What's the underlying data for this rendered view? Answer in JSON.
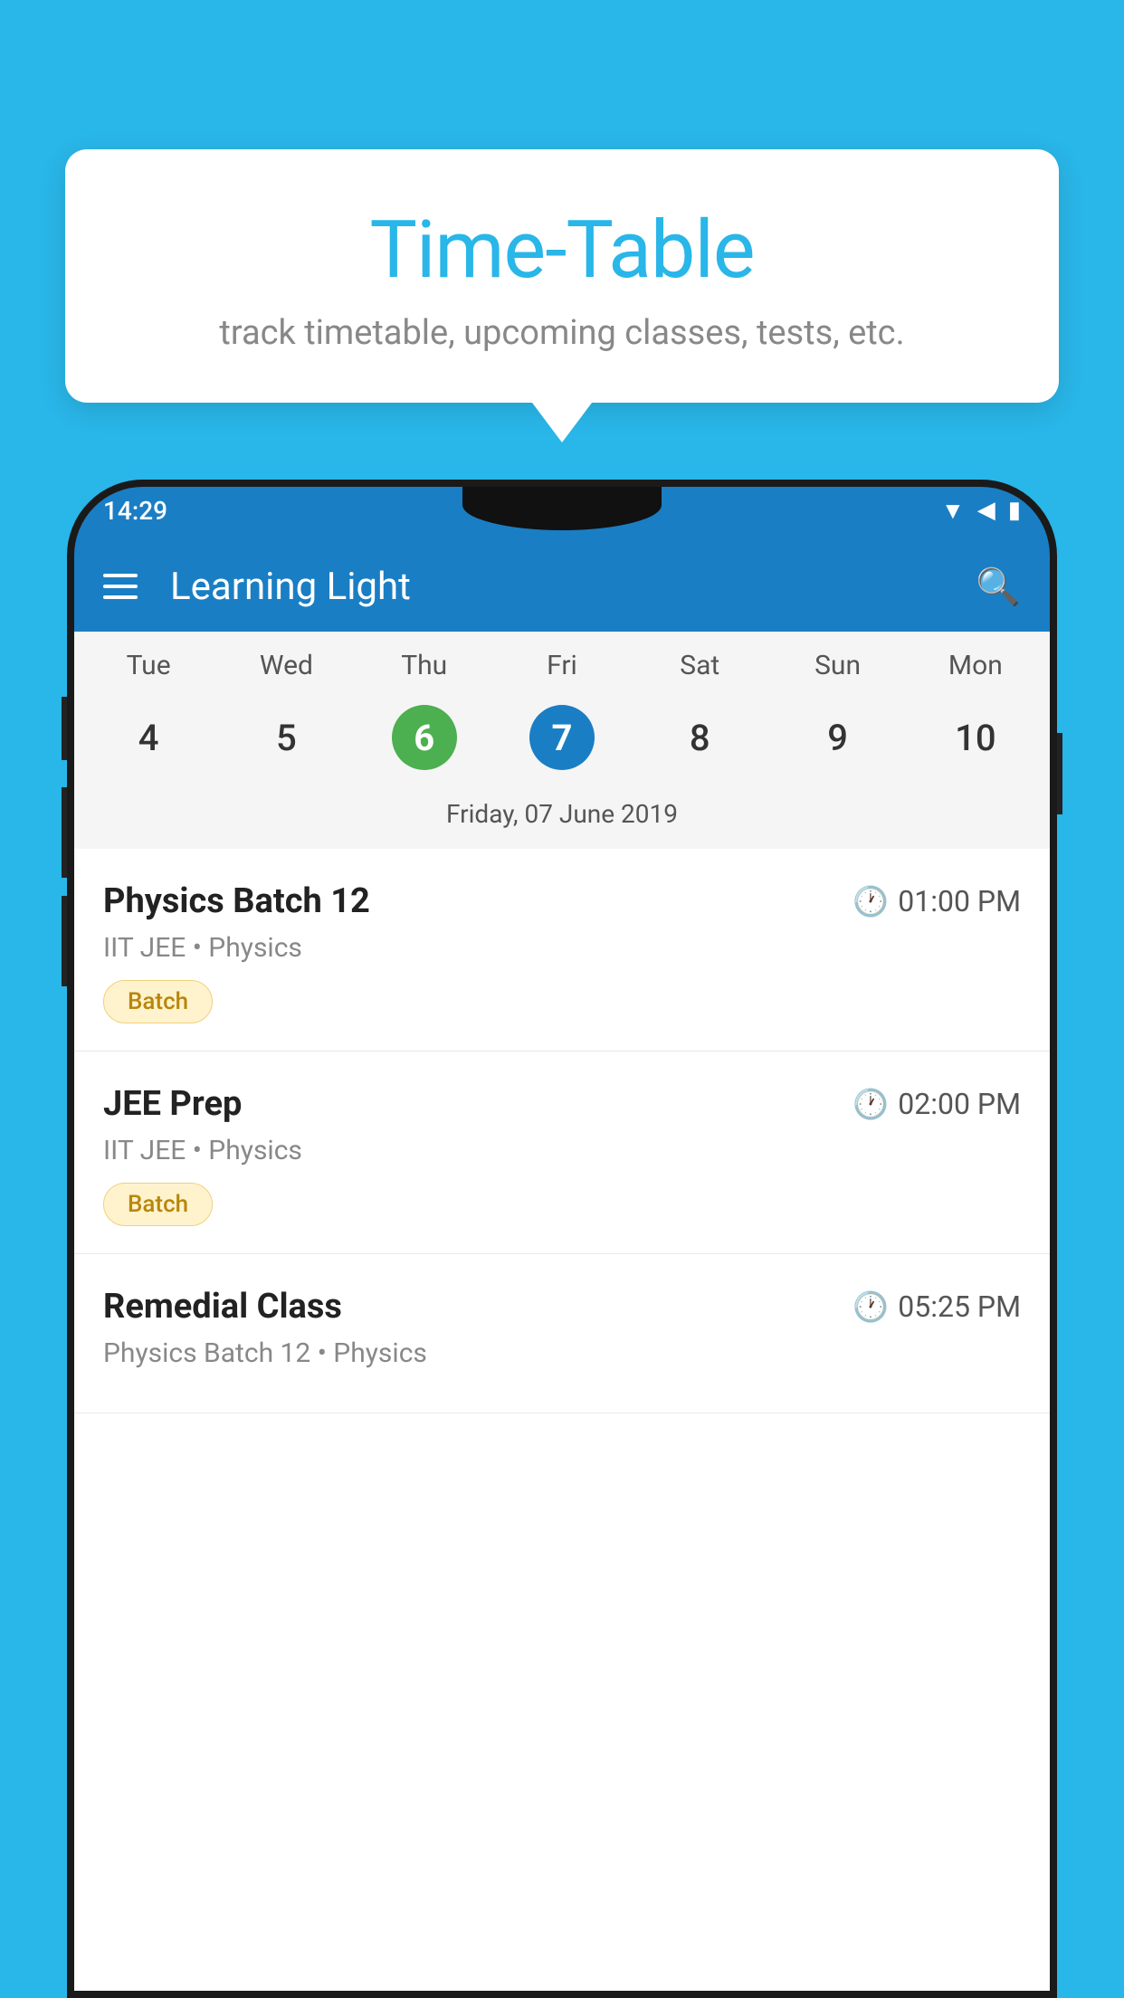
{
  "background_color": "#29b6e8",
  "tooltip": {
    "title": "Time-Table",
    "subtitle": "track timetable, upcoming classes, tests, etc."
  },
  "phone": {
    "status_bar": {
      "time": "14:29"
    },
    "app_bar": {
      "title": "Learning Light"
    },
    "calendar": {
      "day_names": [
        "Tue",
        "Wed",
        "Thu",
        "Fri",
        "Sat",
        "Sun",
        "Mon"
      ],
      "dates": [
        {
          "num": "4",
          "state": "normal"
        },
        {
          "num": "5",
          "state": "normal"
        },
        {
          "num": "6",
          "state": "today"
        },
        {
          "num": "7",
          "state": "selected"
        },
        {
          "num": "8",
          "state": "normal"
        },
        {
          "num": "9",
          "state": "normal"
        },
        {
          "num": "10",
          "state": "normal"
        }
      ],
      "selected_date_label": "Friday, 07 June 2019"
    },
    "schedule": {
      "items": [
        {
          "title": "Physics Batch 12",
          "time": "01:00 PM",
          "subtitle": "IIT JEE • Physics",
          "tag": "Batch"
        },
        {
          "title": "JEE Prep",
          "time": "02:00 PM",
          "subtitle": "IIT JEE • Physics",
          "tag": "Batch"
        },
        {
          "title": "Remedial Class",
          "time": "05:25 PM",
          "subtitle": "Physics Batch 12 • Physics",
          "tag": null
        }
      ]
    }
  }
}
